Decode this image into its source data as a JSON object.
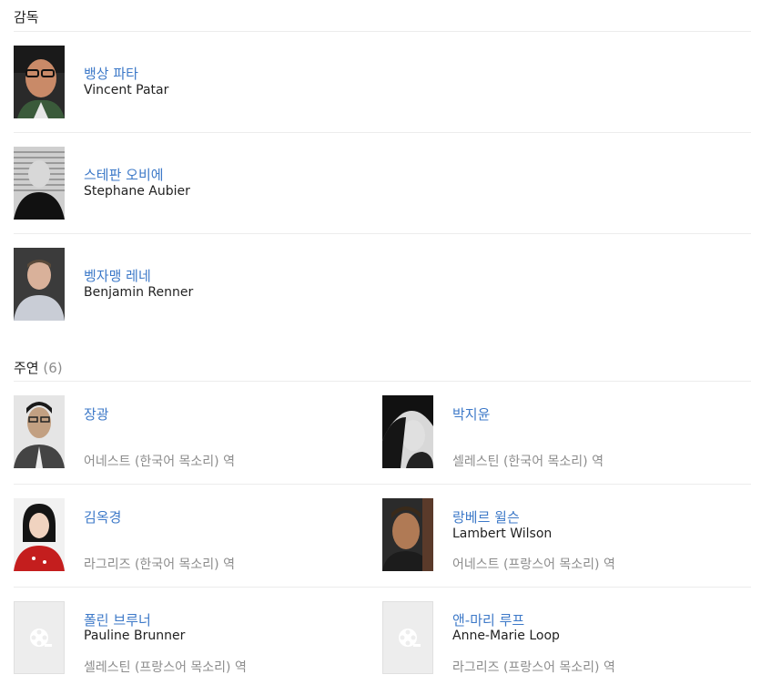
{
  "directors": {
    "title": "감독",
    "people": [
      {
        "name_ko": "뱅상 파타",
        "name_en": "Vincent Patar"
      },
      {
        "name_ko": "스테판 오비에",
        "name_en": "Stephane Aubier"
      },
      {
        "name_ko": "벵자맹 레네",
        "name_en": "Benjamin Renner"
      }
    ]
  },
  "cast": {
    "title": "주연",
    "count": "(6)",
    "people": [
      {
        "name_ko": "장광",
        "name_en": "",
        "role": "어네스트 (한국어 목소리) 역"
      },
      {
        "name_ko": "박지윤",
        "name_en": "",
        "role": "셀레스틴 (한국어 목소리) 역"
      },
      {
        "name_ko": "김옥경",
        "name_en": "",
        "role": "라그리즈 (한국어 목소리) 역"
      },
      {
        "name_ko": "랑베르 윌슨",
        "name_en": "Lambert Wilson",
        "role": "어네스트 (프랑스어 목소리) 역"
      },
      {
        "name_ko": "폴린 브루너",
        "name_en": "Pauline Brunner",
        "role": "셀레스틴 (프랑스어 목소리) 역"
      },
      {
        "name_ko": "앤-마리 루프",
        "name_en": "Anne-Marie Loop",
        "role": "라그리즈 (프랑스어 목소리) 역"
      }
    ]
  }
}
